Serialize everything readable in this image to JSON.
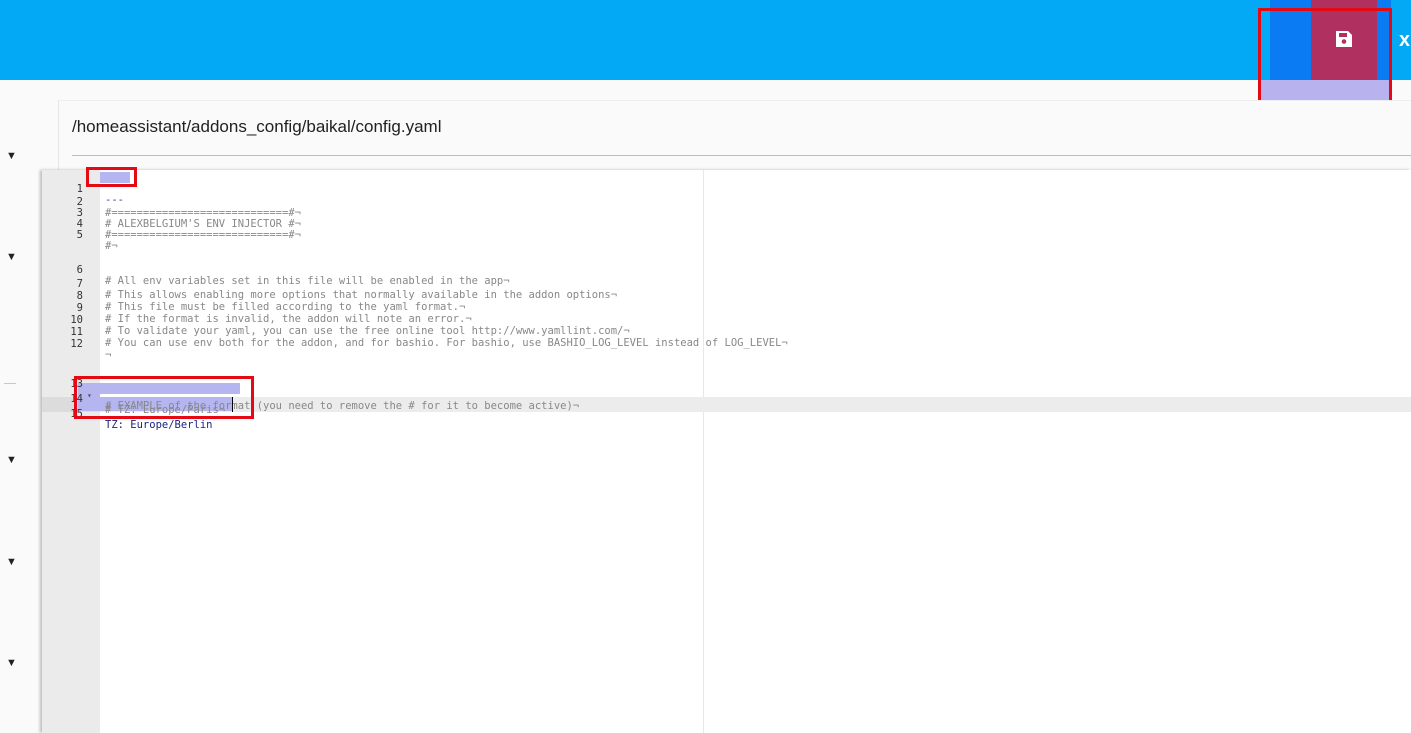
{
  "header": {
    "save_icon": "floppy-disk-icon",
    "close_label": "x"
  },
  "file": {
    "path": "/homeassistant/addons_config/baikal/config.yaml"
  },
  "editor": {
    "lines": [
      {
        "num": "1",
        "text": "---"
      },
      {
        "num": "2",
        "text": "#============================#¬"
      },
      {
        "num": "3",
        "text": "# ALEXBELGIUM'S ENV INJECTOR #¬"
      },
      {
        "num": "4",
        "text": "#============================#¬"
      },
      {
        "num": "5",
        "text": "#¬"
      },
      {
        "num": "6",
        "text": "# All env variables set in this file will be enabled in the app¬"
      },
      {
        "num": "7",
        "text": "# This allows enabling more options that normally available in the addon options¬"
      },
      {
        "num": "8",
        "text": "# This file must be filled according to the yaml format.¬"
      },
      {
        "num": "9",
        "text": "# If the format is invalid, the addon will note an error.¬"
      },
      {
        "num": "10",
        "text": "# To validate your yaml, you can use the free online tool http://www.yamllint.com/¬"
      },
      {
        "num": "11",
        "text": "# You can use env both for the addon, and for bashio. For bashio, use BASHIO_LOG_LEVEL instead of LOG_LEVEL¬"
      },
      {
        "num": "12",
        "text": "¬"
      },
      {
        "num": "13",
        "text": "# EXAMPLE of the format (you need to remove the # for it to become active)¬"
      },
      {
        "num": "14",
        "text": "# TZ: Europe/Paris¬"
      },
      {
        "num": "15",
        "text": "TZ: Europe/Berlin"
      }
    ],
    "fold_marker": "▾"
  },
  "left_panel": {
    "collapse_glyph": "▼"
  }
}
